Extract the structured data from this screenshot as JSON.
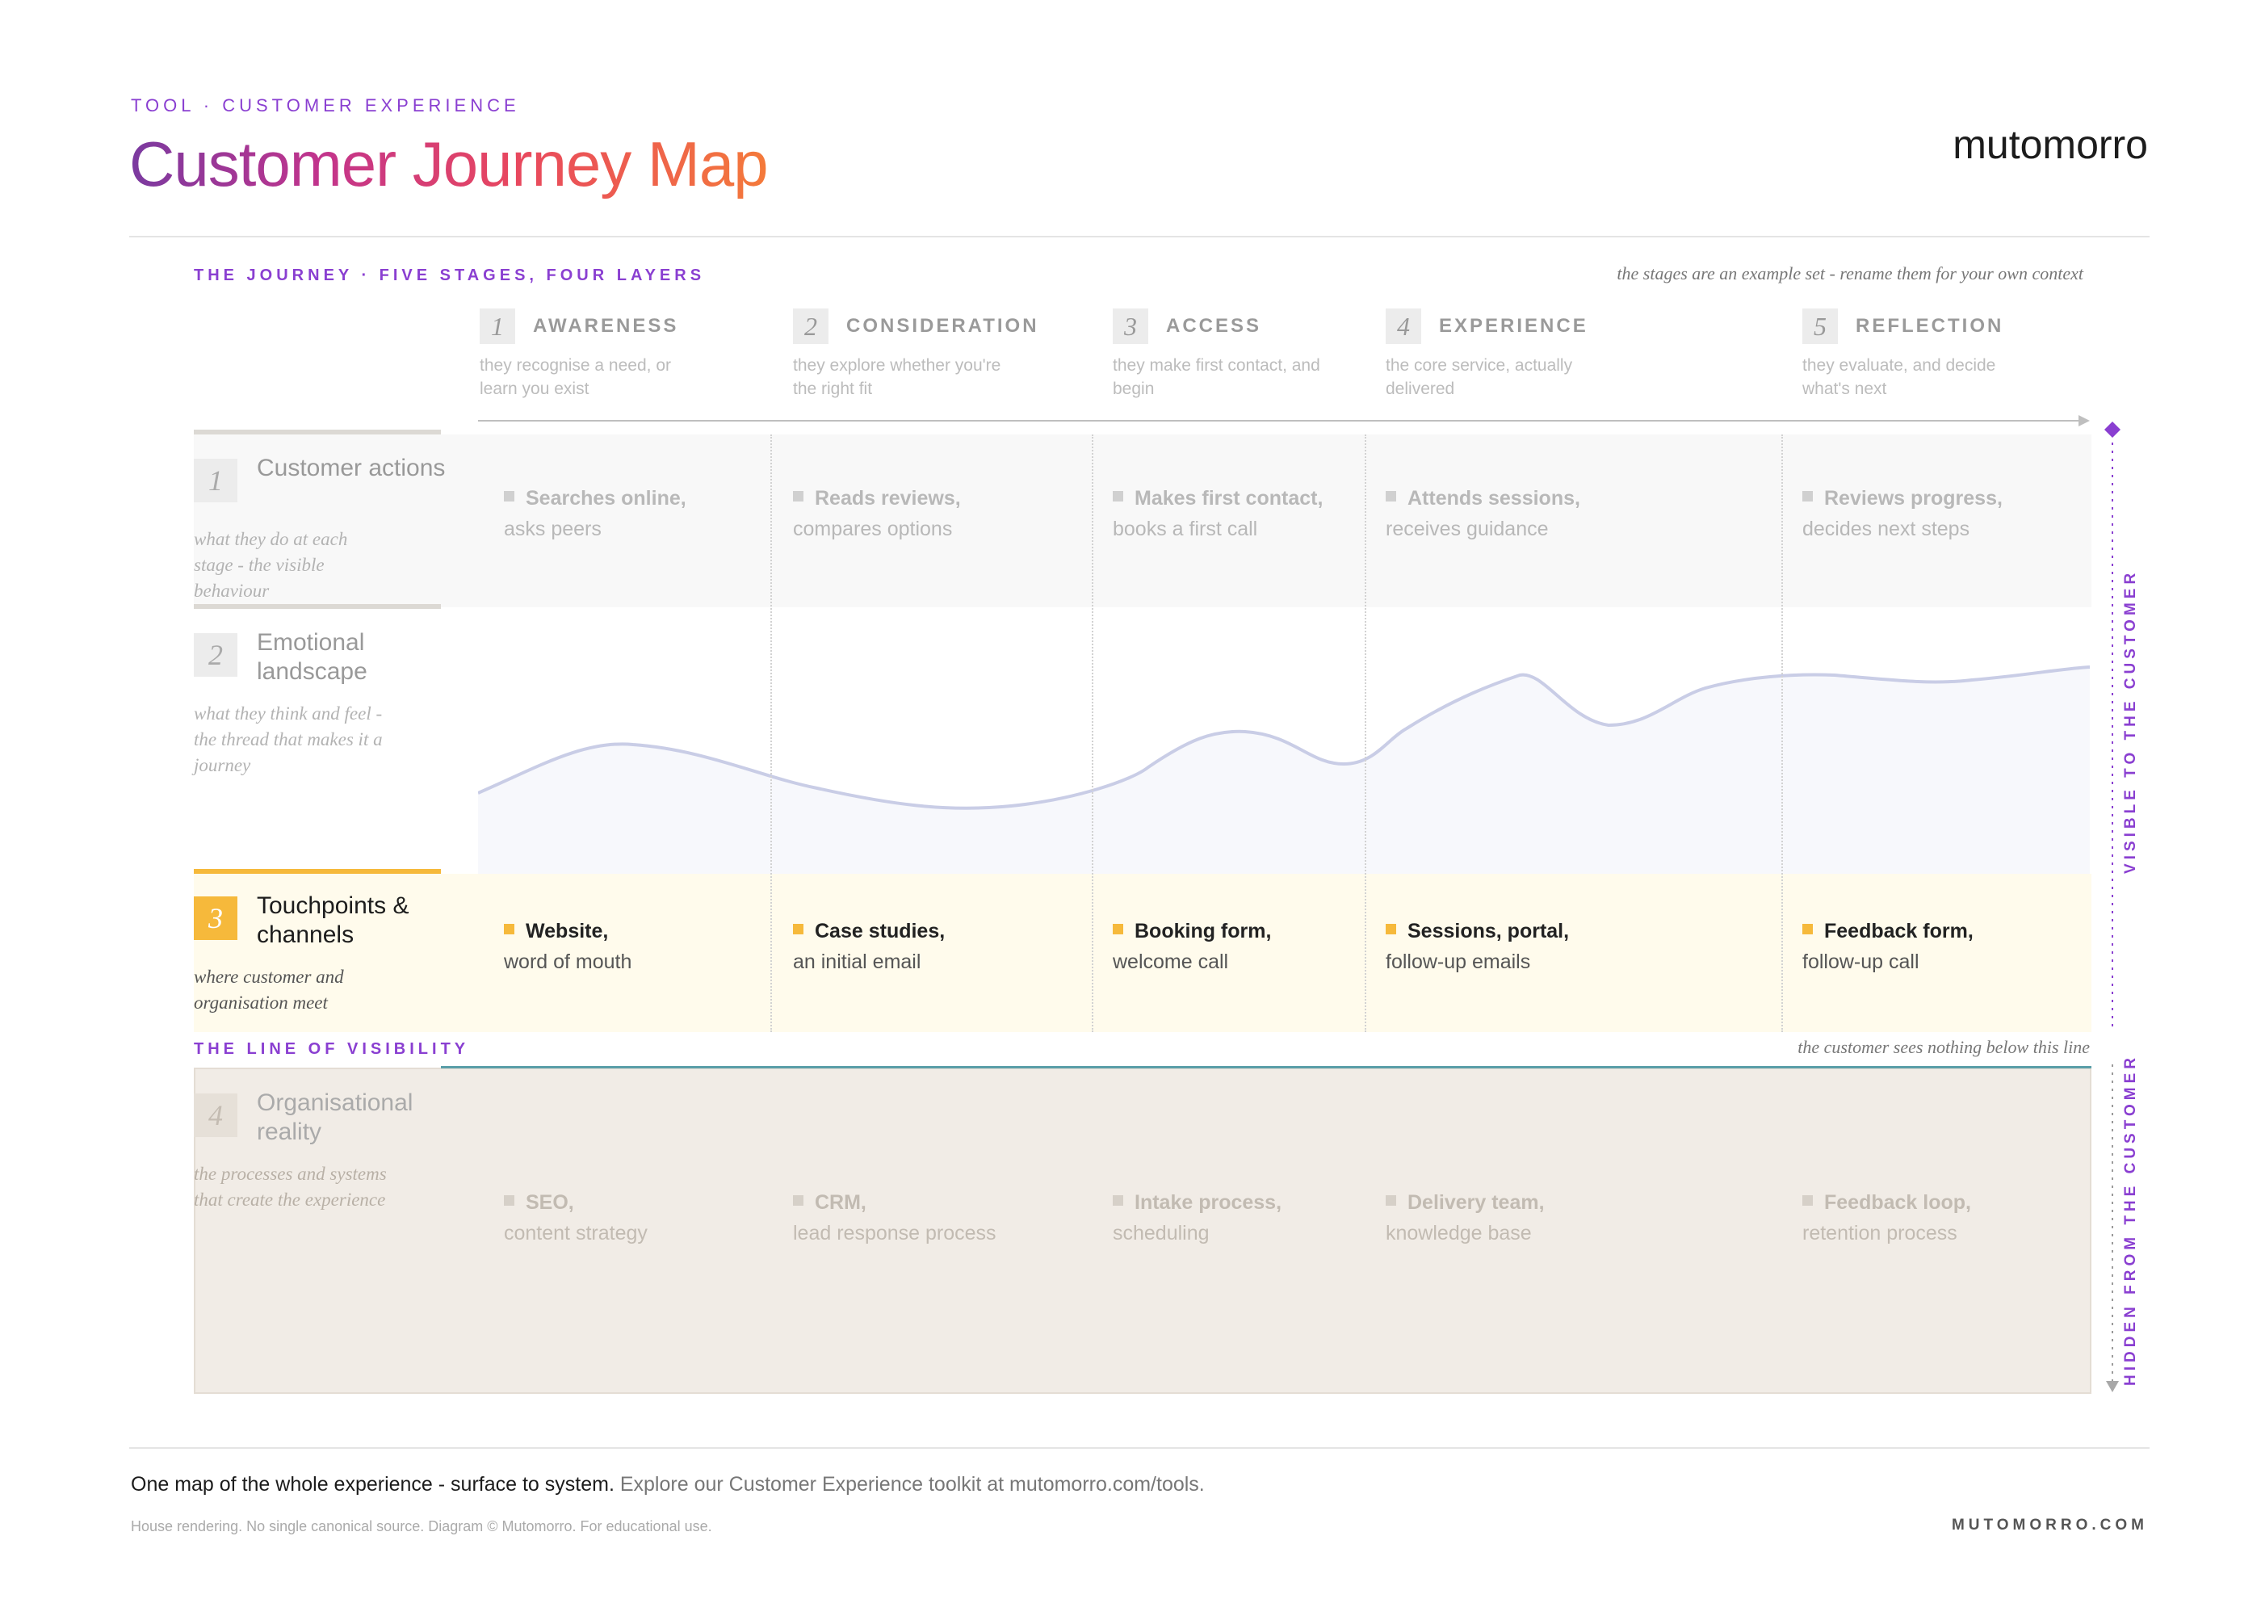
{
  "header": {
    "eyebrow": "TOOL · CUSTOMER EXPERIENCE",
    "title": "Customer Journey Map",
    "brand": "mutomorro"
  },
  "journey": {
    "section_label": "THE JOURNEY · FIVE STAGES, FOUR LAYERS",
    "note": "the stages are an example set - rename them for your own context",
    "stages": [
      {
        "num": "1",
        "name": "AWARENESS",
        "desc": "they recognise a need, or learn you exist"
      },
      {
        "num": "2",
        "name": "CONSIDERATION",
        "desc": "they explore whether you're the right fit"
      },
      {
        "num": "3",
        "name": "ACCESS",
        "desc": "they make first contact, and begin"
      },
      {
        "num": "4",
        "name": "EXPERIENCE",
        "desc": "the core service, actually delivered"
      },
      {
        "num": "5",
        "name": "REFLECTION",
        "desc": "they evaluate, and decide what's next"
      }
    ]
  },
  "layers": [
    {
      "num": "1",
      "title": "Customer actions",
      "desc": "what they do at each stage - the visible behaviour",
      "cells": [
        {
          "strong": "Searches online,",
          "rest": "asks peers"
        },
        {
          "strong": "Reads reviews,",
          "rest": "compares options"
        },
        {
          "strong": "Makes first contact,",
          "rest": "books a first call"
        },
        {
          "strong": "Attends sessions,",
          "rest": "receives guidance"
        },
        {
          "strong": "Reviews progress,",
          "rest": "decides next steps"
        }
      ]
    },
    {
      "num": "2",
      "title": "Emotional landscape",
      "desc": "what they think and feel - the thread that makes it a journey"
    },
    {
      "num": "3",
      "title": "Touchpoints & channels",
      "desc": "where customer and organisation meet",
      "cells": [
        {
          "strong": "Website,",
          "rest": "word of mouth"
        },
        {
          "strong": "Case studies,",
          "rest": "an initial email"
        },
        {
          "strong": "Booking form,",
          "rest": "welcome call"
        },
        {
          "strong": "Sessions, portal,",
          "rest": "follow-up emails"
        },
        {
          "strong": "Feedback form,",
          "rest": "follow-up call"
        }
      ]
    },
    {
      "num": "4",
      "title": "Organisational reality",
      "desc": "the processes and systems that create the experience",
      "cells": [
        {
          "strong": "SEO,",
          "rest": "content strategy"
        },
        {
          "strong": "CRM,",
          "rest": "lead response process"
        },
        {
          "strong": "Intake process,",
          "rest": "scheduling"
        },
        {
          "strong": "Delivery team,",
          "rest": "knowledge base"
        },
        {
          "strong": "Feedback loop,",
          "rest": "retention process"
        }
      ]
    }
  ],
  "visibility": {
    "label": "THE LINE OF VISIBILITY",
    "note": "the customer sees nothing below this line",
    "visible_side": "VISIBLE TO THE CUSTOMER",
    "hidden_side": "HIDDEN FROM THE CUSTOMER"
  },
  "footer": {
    "lead": "One map of the whole experience - surface to system.",
    "rest": " Explore our Customer Experience toolkit at mutomorro.com/tools.",
    "small": "House rendering. No single canonical source. Diagram © Mutomorro. For educational use.",
    "site": "MUTOMORRO.COM"
  },
  "colors": {
    "accent": "#8a3fd1",
    "touchpoint_yellow": "#f6b93b",
    "curve": "#c9cde6",
    "org_band": "#f1ece6",
    "visibility_line": "#5a9ea8"
  }
}
